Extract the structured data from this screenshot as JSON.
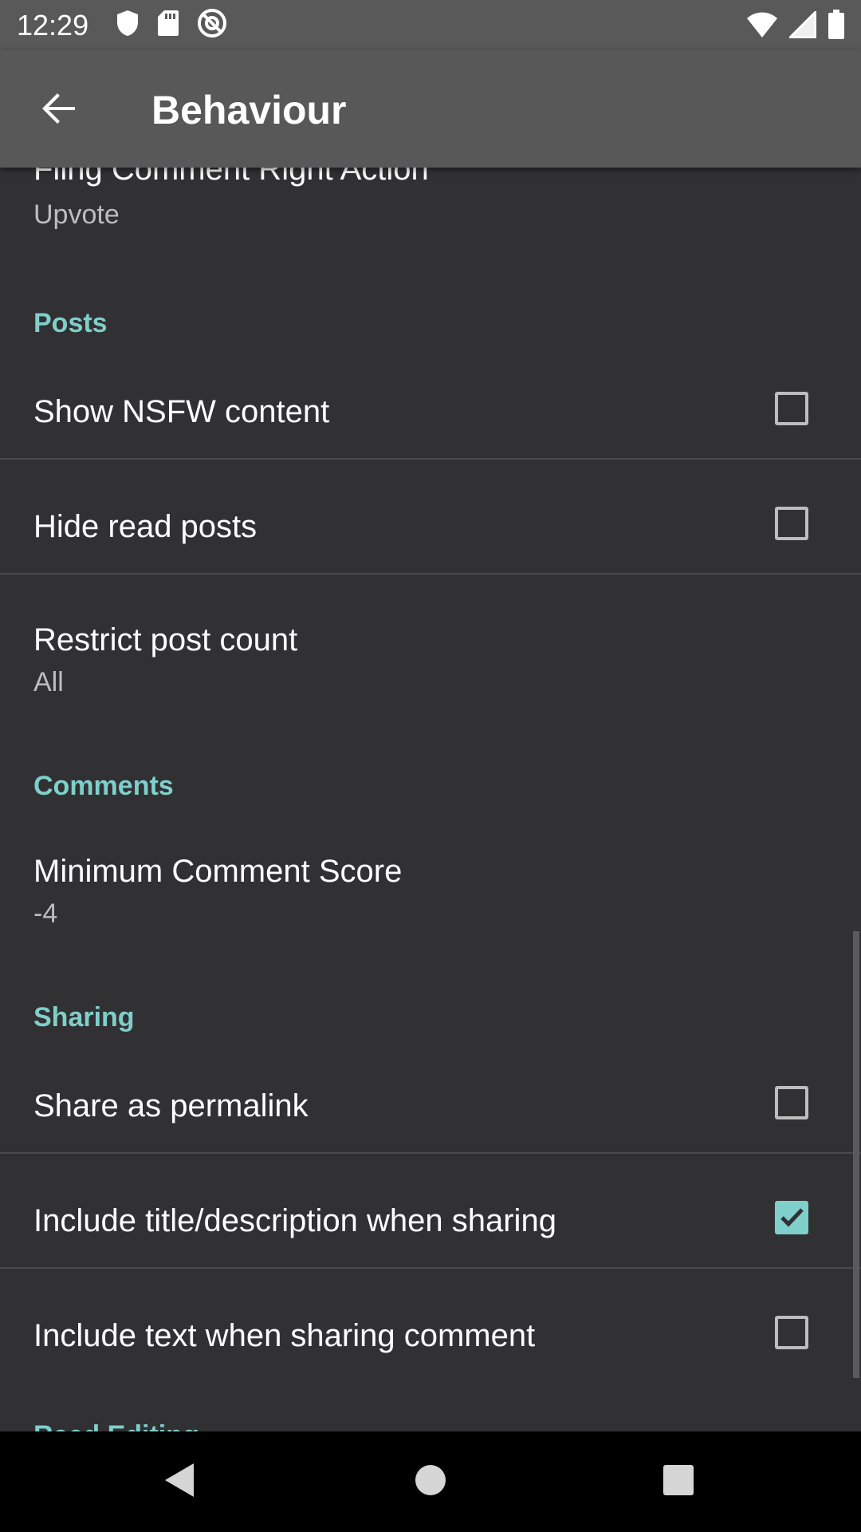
{
  "status_bar": {
    "time": "12:29",
    "left_icons": [
      "shield-icon",
      "sd-card-icon",
      "no-sync-icon"
    ],
    "right_icons": [
      "wifi-icon",
      "signal-icon",
      "battery-icon"
    ]
  },
  "app_bar": {
    "title": "Behaviour",
    "back_icon": "arrow-back-icon"
  },
  "settings": {
    "partial_top": {
      "title": "Fling Comment Right Action",
      "value": "Upvote"
    },
    "posts_header": "Posts",
    "show_nsfw": {
      "label": "Show NSFW content",
      "checked": false
    },
    "hide_read": {
      "label": "Hide read posts",
      "checked": false
    },
    "restrict_count": {
      "title": "Restrict post count",
      "value": "All"
    },
    "comments_header": "Comments",
    "min_comment_score": {
      "title": "Minimum Comment Score",
      "value": "-4"
    },
    "sharing_header": "Sharing",
    "share_permalink": {
      "label": "Share as permalink",
      "checked": false
    },
    "include_title": {
      "label": "Include title/description when sharing",
      "checked": true
    },
    "include_text": {
      "label": "Include text when sharing comment",
      "checked": false
    },
    "partial_bottom_header": "Reed Editing"
  },
  "nav_bar": {
    "icons": [
      "back-triangle-icon",
      "home-circle-icon",
      "recents-square-icon"
    ]
  },
  "colors": {
    "background": "#313133",
    "app_bar": "#585858",
    "accent": "#7fcfcb"
  }
}
